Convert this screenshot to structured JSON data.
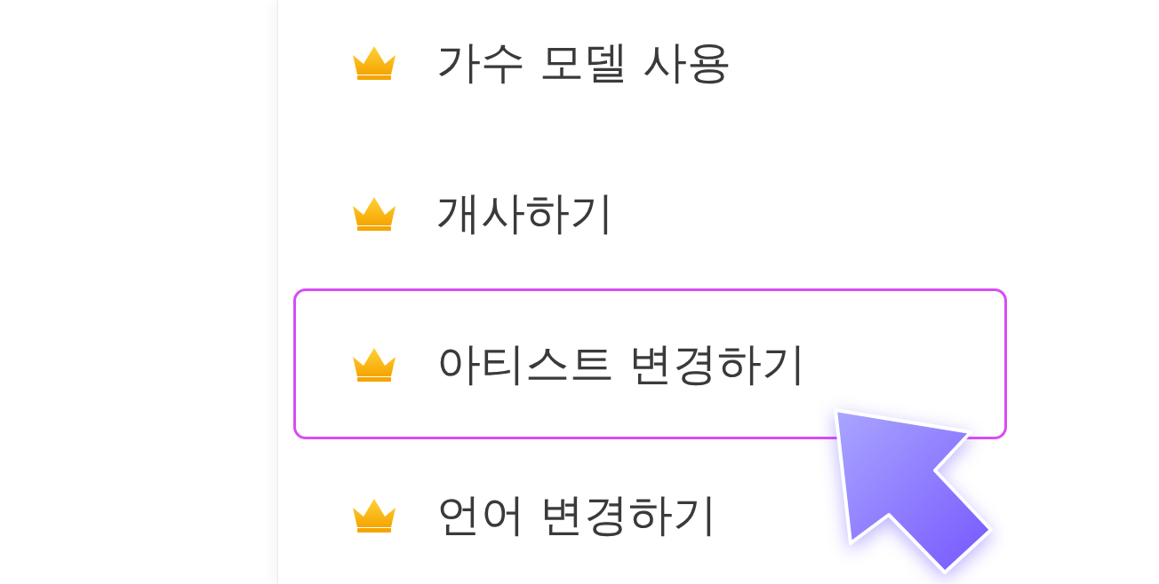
{
  "menu": {
    "items": [
      {
        "label": "가수 모델 사용",
        "premium": true,
        "selected": false
      },
      {
        "label": "개사하기",
        "premium": true,
        "selected": false
      },
      {
        "label": "아티스트 변경하기",
        "premium": true,
        "selected": true
      },
      {
        "label": "언어 변경하기",
        "premium": true,
        "selected": false
      }
    ]
  }
}
